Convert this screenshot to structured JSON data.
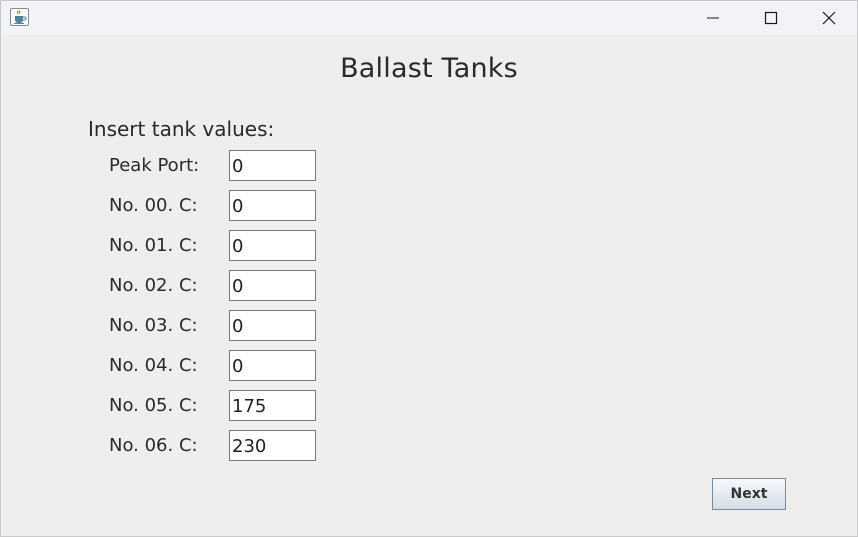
{
  "window": {
    "title": "",
    "controls": [
      "minimize",
      "maximize",
      "close"
    ]
  },
  "heading": "Ballast Tanks",
  "instructions": "Insert tank values:",
  "tanks": [
    {
      "label": "Peak Port:",
      "value": "0"
    },
    {
      "label": "No. 00. C:",
      "value": "0"
    },
    {
      "label": "No. 01. C:",
      "value": "0"
    },
    {
      "label": "No. 02. C:",
      "value": "0"
    },
    {
      "label": "No. 03. C:",
      "value": "0"
    },
    {
      "label": "No. 04. C:",
      "value": "0"
    },
    {
      "label": "No. 05. C:",
      "value": "175"
    },
    {
      "label": "No. 06. C:",
      "value": "230"
    }
  ],
  "next_label": "Next",
  "icons": {
    "app": "java-coffee-cup-icon",
    "minimize": "minimize-icon",
    "maximize": "maximize-icon",
    "close": "close-icon"
  }
}
